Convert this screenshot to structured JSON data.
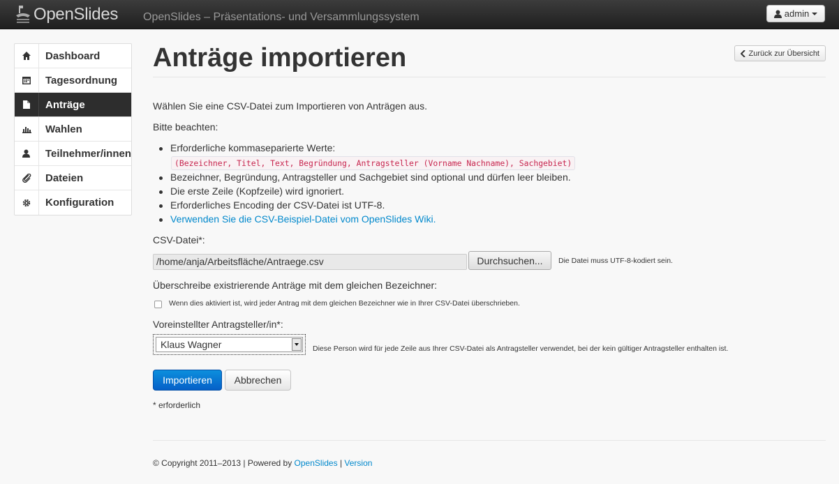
{
  "navbar": {
    "brand": "OpenSlides",
    "subtitle": "OpenSlides – Präsentations- und Versammlungssystem",
    "user": "admin"
  },
  "sidebar": {
    "items": [
      {
        "label": "Dashboard",
        "icon": "home-icon"
      },
      {
        "label": "Tagesordnung",
        "icon": "calendar-icon"
      },
      {
        "label": "Anträge",
        "icon": "file-icon",
        "active": true
      },
      {
        "label": "Wahlen",
        "icon": "bar-chart-icon"
      },
      {
        "label": "Teilnehmer/innen",
        "icon": "user-icon"
      },
      {
        "label": "Dateien",
        "icon": "paperclip-icon"
      },
      {
        "label": "Konfiguration",
        "icon": "cog-icon"
      }
    ]
  },
  "main": {
    "title": "Anträge importieren",
    "back_label": "Zurück zur Übersicht",
    "intro": "Wählen Sie eine CSV-Datei zum Importieren von Anträgen aus.",
    "note_heading": "Bitte beachten:",
    "bullets": [
      "Erforderliche kommaseparierte Werte:",
      "Bezeichner, Begründung, Antragsteller und Sachgebiet sind optional und dürfen leer bleiben.",
      "Die erste Zeile (Kopfzeile) wird ignoriert.",
      "Erforderliches Encoding der CSV-Datei ist UTF-8."
    ],
    "required_values": "(Bezeichner, Titel, Text, Begründung, Antragsteller (Vorname Nachname), Sachgebiet)",
    "wiki_link": "Verwenden Sie die CSV-Beispiel-Datei vom OpenSlides Wiki.",
    "csv_label": "CSV-Datei*:",
    "csv_value": "/home/anja/Arbeitsfläche/Antraege.csv",
    "browse_label": "Durchsuchen...",
    "csv_help": "Die Datei muss UTF-8-kodiert sein.",
    "overwrite_label": "Überschreibe existrierende Anträge mit dem gleichen Bezeichner:",
    "overwrite_help": "Wenn dies aktiviert ist, wird jeder Antrag mit dem gleichen Bezeichner wie in Ihrer CSV-Datei überschrieben.",
    "submitter_label": "Voreinstellter Antragsteller/in*:",
    "submitter_value": "Klaus Wagner",
    "submitter_help": "Diese Person wird für jede Zeile aus Ihrer CSV-Datei als Antragsteller verwendet, bei der kein gültiger Antragsteller enthalten ist.",
    "import_label": "Importieren",
    "cancel_label": "Abbrechen",
    "required_note": "* erforderlich"
  },
  "footer": {
    "copyright": "© Copyright 2011–2013 | Powered by",
    "brand_link": "OpenSlides",
    "separator": "|",
    "version_link": "Version"
  }
}
